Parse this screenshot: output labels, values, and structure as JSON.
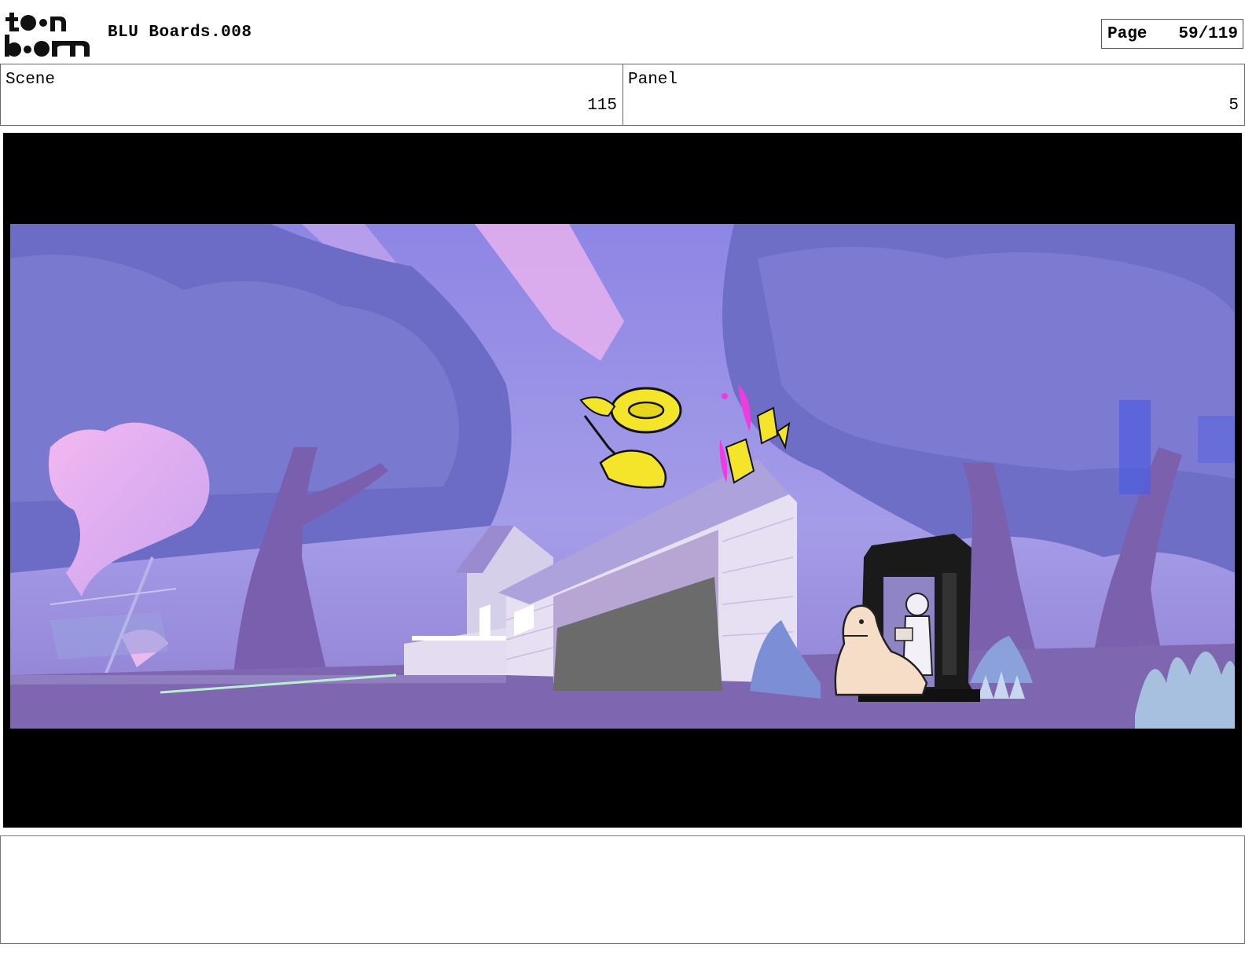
{
  "header": {
    "logo_text": "toon boom",
    "title": "BLU Boards.008",
    "page_label": "Page",
    "page_value": "59/119"
  },
  "info": {
    "scene_label": "Scene",
    "scene_value": "115",
    "panel_label": "Panel",
    "panel_value": "5"
  },
  "frame": {
    "image_description_icon": "storyboard-frame-image",
    "sky_color": "#9a93e6",
    "tree_color": "#6d6cc4",
    "ground_color": "#7f68b0"
  },
  "notes": {
    "text": ""
  }
}
